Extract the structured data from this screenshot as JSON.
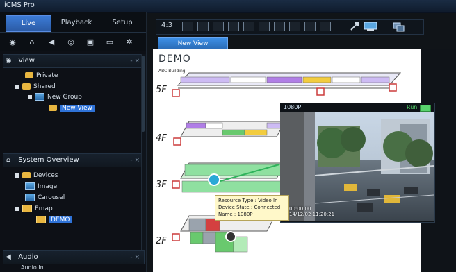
{
  "app": {
    "title": "iCMS Pro"
  },
  "tabs": {
    "live": "Live",
    "playback": "Playback",
    "setup": "Setup"
  },
  "toolbar_icons": [
    "eye-icon",
    "tree-icon",
    "speaker-icon",
    "compass-icon",
    "camera-icon",
    "monitor-icon",
    "gear-icon"
  ],
  "view_panel": {
    "title": "View",
    "items": [
      {
        "label": "Private"
      },
      {
        "label": "Shared"
      },
      {
        "label": "New Group"
      },
      {
        "label": "New View"
      }
    ]
  },
  "system_overview": {
    "title": "System Overview",
    "items": [
      {
        "label": "Devices"
      },
      {
        "label": "Image"
      },
      {
        "label": "Carousel"
      },
      {
        "label": "Emap"
      },
      {
        "label": "DEMO"
      }
    ]
  },
  "audio": {
    "title": "Audio",
    "sub": "Audio In"
  },
  "view_toolbar": {
    "ratio": "4:3"
  },
  "view_tab": {
    "label": "New View"
  },
  "map": {
    "title": "DEMO",
    "building_label": "ABC Building",
    "floors": [
      "5F",
      "4F",
      "3F",
      "2F"
    ]
  },
  "video": {
    "name": "1080P",
    "status": "Run",
    "time_line1": "00:00:00",
    "time_line2": "14/12/02 11:20:21"
  },
  "tooltip": {
    "line1": "Resource Type : Video In",
    "line2": "Device State : Connected",
    "line3": "Name : 1080P"
  },
  "colors": {
    "live_tab": "#3c7bd6",
    "selected": "#2f73d8",
    "floor_green": "#69c96e",
    "floor_purple": "#b07ee6",
    "floor_yellow": "#f2cc3f",
    "floor_red": "#d44040"
  }
}
